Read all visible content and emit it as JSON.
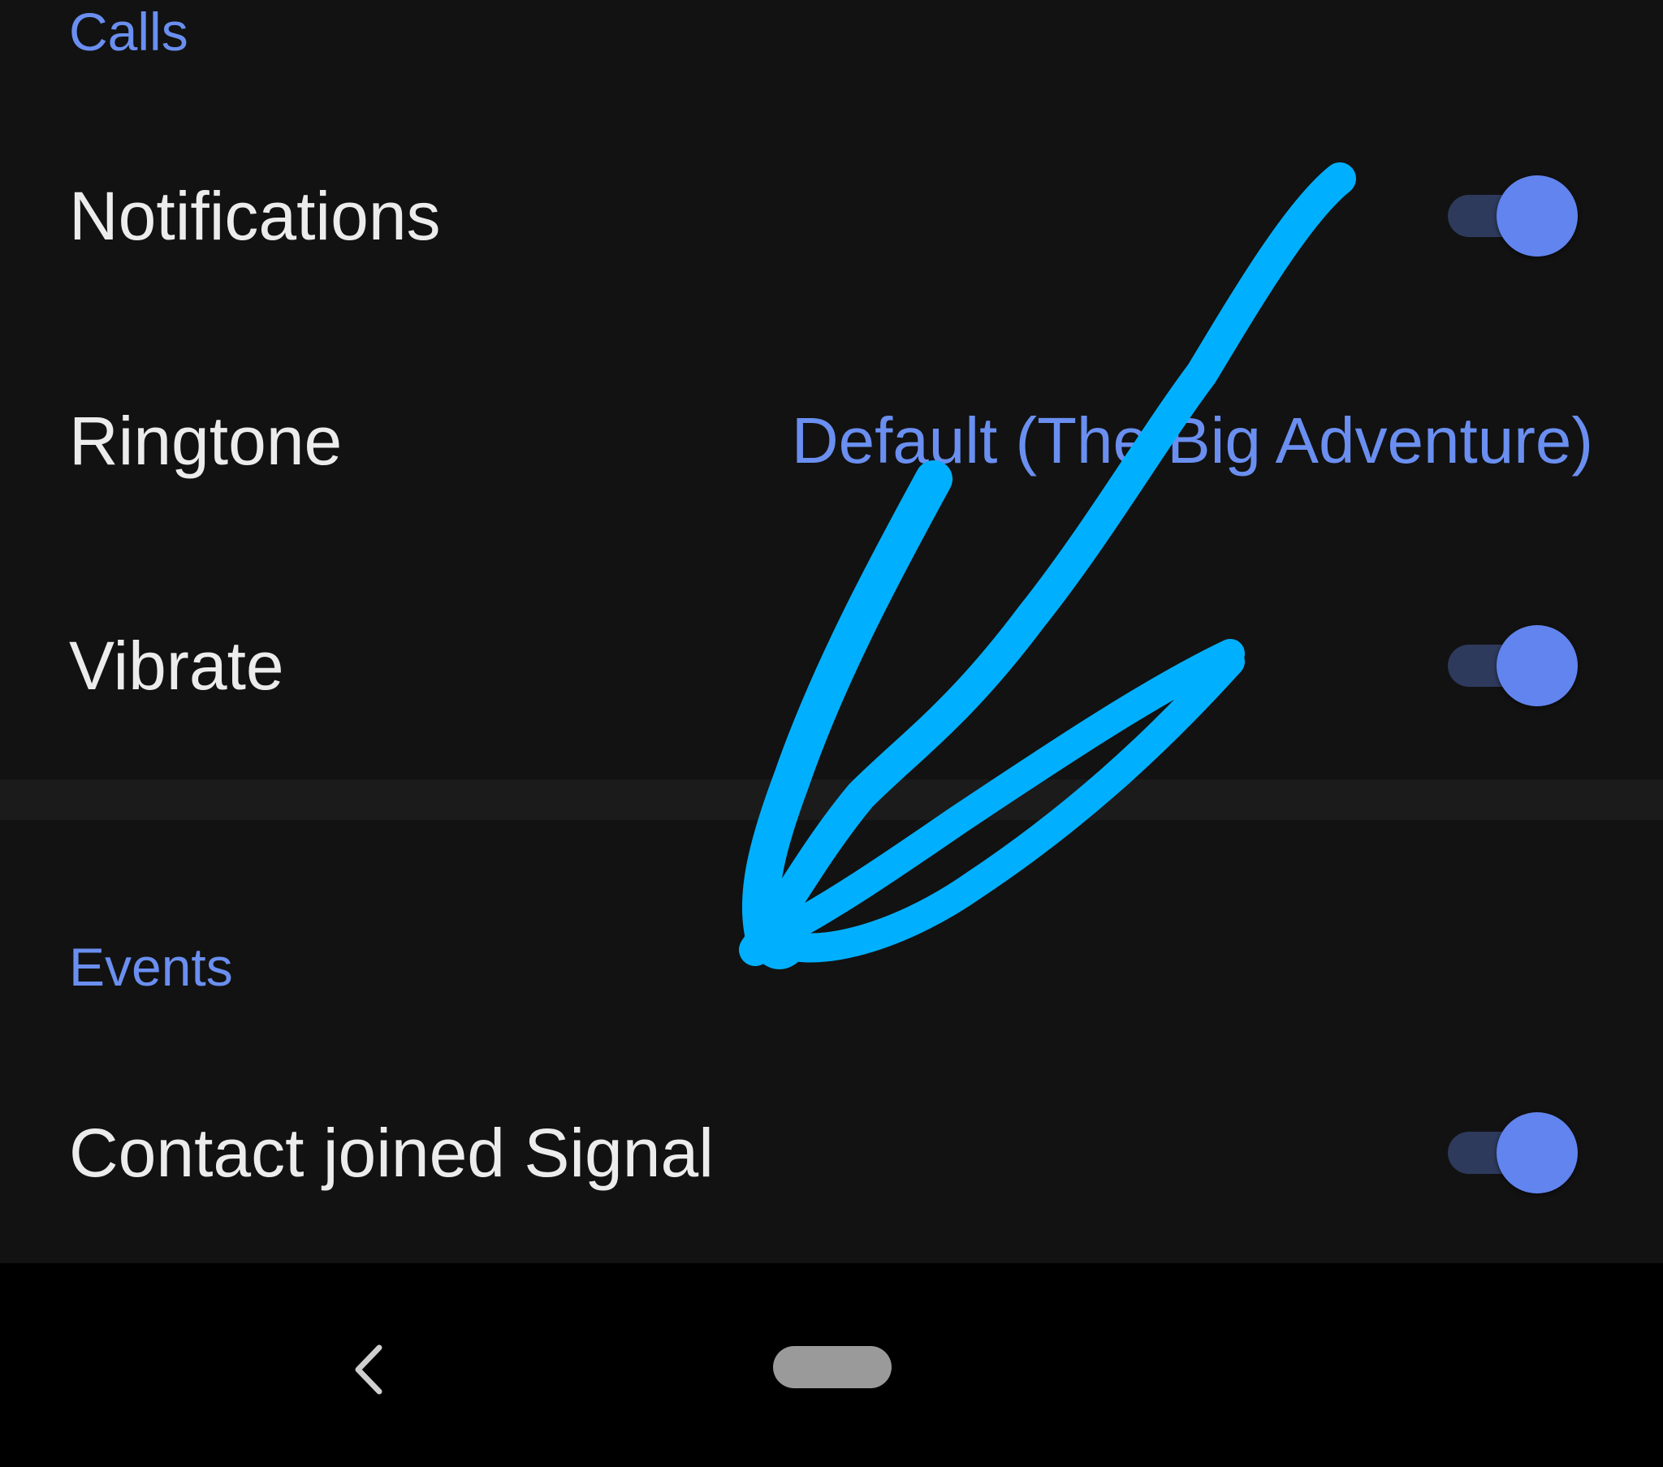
{
  "calls_section": {
    "header": "Calls",
    "notifications": {
      "label": "Notifications",
      "enabled": true
    },
    "ringtone": {
      "label": "Ringtone",
      "value": "Default (The Big Adventure)"
    },
    "vibrate": {
      "label": "Vibrate",
      "enabled": true
    }
  },
  "events_section": {
    "header": "Events",
    "contact_joined": {
      "label": "Contact joined Signal",
      "enabled": true
    }
  },
  "colors": {
    "background": "#121212",
    "accent": "#6a8ff0",
    "toggle_thumb": "#6184ee",
    "toggle_track": "#2e3a5c",
    "annotation_stroke": "#00b0ff",
    "navbar": "#000000"
  },
  "icons": {
    "back": "chevron-left-icon",
    "home": "home-pill-icon"
  }
}
